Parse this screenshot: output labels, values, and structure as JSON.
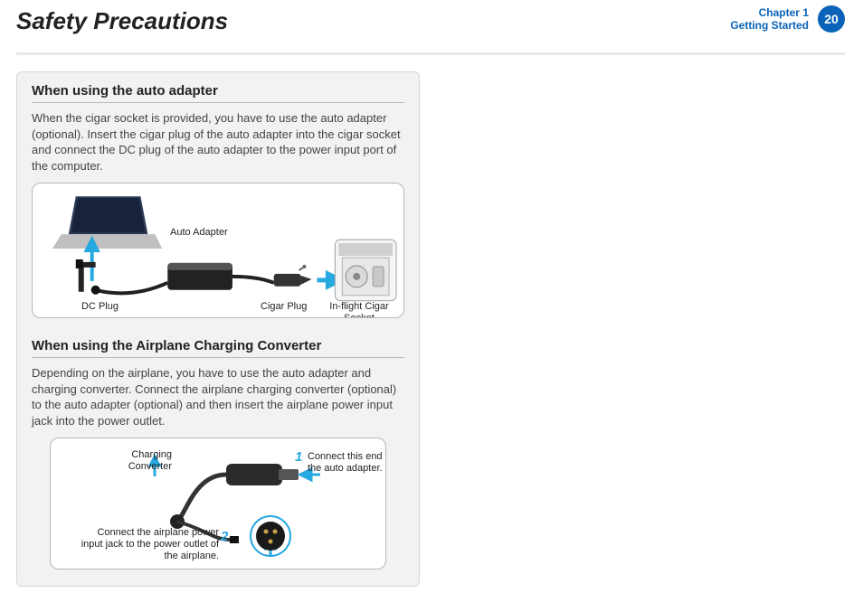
{
  "header": {
    "title": "Safety Precautions",
    "chapter_line1": "Chapter 1",
    "chapter_line2": "Getting Started",
    "page_number": "20"
  },
  "section1": {
    "heading": "When using the auto adapter",
    "body": "When the cigar socket is provided, you have to use the auto adapter (optional). Insert the cigar plug of the auto adapter into the cigar socket and connect the DC plug of the auto adapter to the power input port of the computer.",
    "figure": {
      "auto_adapter": "Auto Adapter",
      "dc_plug": "DC Plug",
      "cigar_plug": "Cigar Plug",
      "inflight_socket": "In-flight Cigar Socket"
    }
  },
  "section2": {
    "heading": "When using the Airplane Charging Converter",
    "body": "Depending on the airplane, you have to use the auto adapter and charging converter. Connect the airplane charging converter (optional) to the auto adapter (optional) and then insert the airplane power input jack into the power outlet.",
    "figure": {
      "charging_converter": "Charging Converter",
      "step1_num": "1",
      "step1_text": "Connect this end to the auto adapter.",
      "step2_num": "2",
      "step2_text": "Connect the airplane power input jack to the power outlet of the airplane."
    }
  }
}
